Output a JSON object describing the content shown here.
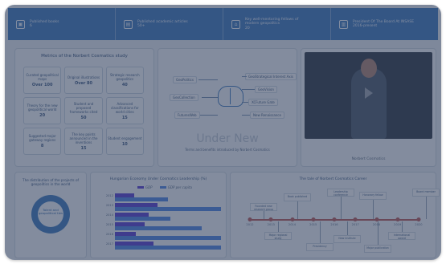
{
  "stats": [
    {
      "icon": "document-icon",
      "line1": "Published books",
      "line2": "6"
    },
    {
      "icon": "academic-icon",
      "line1": "Published academic articles",
      "line2": "50+"
    },
    {
      "icon": "tag-icon",
      "line1": "Key well-mentoring fellows of",
      "line2": "modern geopolitics",
      "line3": "20"
    },
    {
      "icon": "id-card-icon",
      "line1": "President Of The Board At INSASE",
      "line2": "2016-present"
    }
  ],
  "metrics": {
    "title": "Metrics of the Norbert Cosmatics study",
    "cells": [
      {
        "label": "Curated geopolitical maps",
        "value": "Over 100"
      },
      {
        "label": "Original illustrations",
        "value": "Over 80"
      },
      {
        "label": "Strategic research geopolitics",
        "value": "40"
      },
      {
        "label": "Theory for the new geopolitical world",
        "value": "20"
      },
      {
        "label": "Student and proposed frameworks cited",
        "value": "50"
      },
      {
        "label": "Advanced classifications for world cities",
        "value": "15"
      },
      {
        "label": "Suggested major gateway regions",
        "value": "8"
      },
      {
        "label": "The key points announced in the inventions",
        "value": "15"
      },
      {
        "label": "Student engagement",
        "value": "10"
      }
    ]
  },
  "center": {
    "left_labels": [
      "GeoPolitics",
      "GeoCollection",
      "FuturesWeb"
    ],
    "right_labels": [
      "GeoStrategical Interest Axis",
      "GeoVision",
      "XCFuture Gate",
      "New Renaissance"
    ],
    "big_text": "Under New",
    "sub_text": "Terms and benefits introduced by Norbert Cosmatics"
  },
  "video": {
    "caption": "Norbert Cosmatics"
  },
  "donut": {
    "title": "The distribution of the projects of geopolitics in the world",
    "center_label": "Talent and geopolitical ties"
  },
  "bar_chart": {
    "title": "Hungarian Economy Under Cosmatics Leadership (%)",
    "legend": [
      "GDP",
      "GDP per capita"
    ],
    "colors": [
      "#4a2ecf",
      "#3f7ae0"
    ],
    "chart_data": {
      "type": "bar",
      "categories": [
        "2012",
        "2013",
        "2014",
        "2015",
        "2016",
        "2017"
      ],
      "series": [
        {
          "name": "GDP",
          "values": [
            18,
            40,
            32,
            28,
            20,
            36
          ]
        },
        {
          "name": "GDP per capita",
          "values": [
            50,
            100,
            52,
            82,
            100,
            100
          ]
        }
      ],
      "ylim": [
        0,
        100
      ]
    }
  },
  "timeline": {
    "title": "The tale of Norbert Cosmatics Career",
    "years": [
      "2012",
      "2013",
      "2014",
      "2015",
      "2016",
      "2017",
      "2018",
      "2019",
      "2020"
    ],
    "events_top": [
      {
        "text": "Founded new research group",
        "x": 24,
        "y": 38,
        "line_to": 58
      },
      {
        "text": "Book published",
        "x": 66,
        "y": 26,
        "line_to": 58
      },
      {
        "text": "Leadership conference",
        "x": 120,
        "y": 20,
        "line_to": 58
      },
      {
        "text": "Honorary fellow",
        "x": 160,
        "y": 24,
        "line_to": 58
      },
      {
        "text": "Board member",
        "x": 226,
        "y": 20,
        "line_to": 58
      }
    ],
    "events_bottom": [
      {
        "text": "Major regional study",
        "x": 42,
        "y": 74,
        "line_to": 61
      },
      {
        "text": "Presidency",
        "x": 94,
        "y": 88,
        "line_to": 61
      },
      {
        "text": "New institute",
        "x": 128,
        "y": 78,
        "line_to": 61
      },
      {
        "text": "Major publication",
        "x": 166,
        "y": 90,
        "line_to": 61
      },
      {
        "text": "International award",
        "x": 196,
        "y": 74,
        "line_to": 61
      }
    ]
  }
}
